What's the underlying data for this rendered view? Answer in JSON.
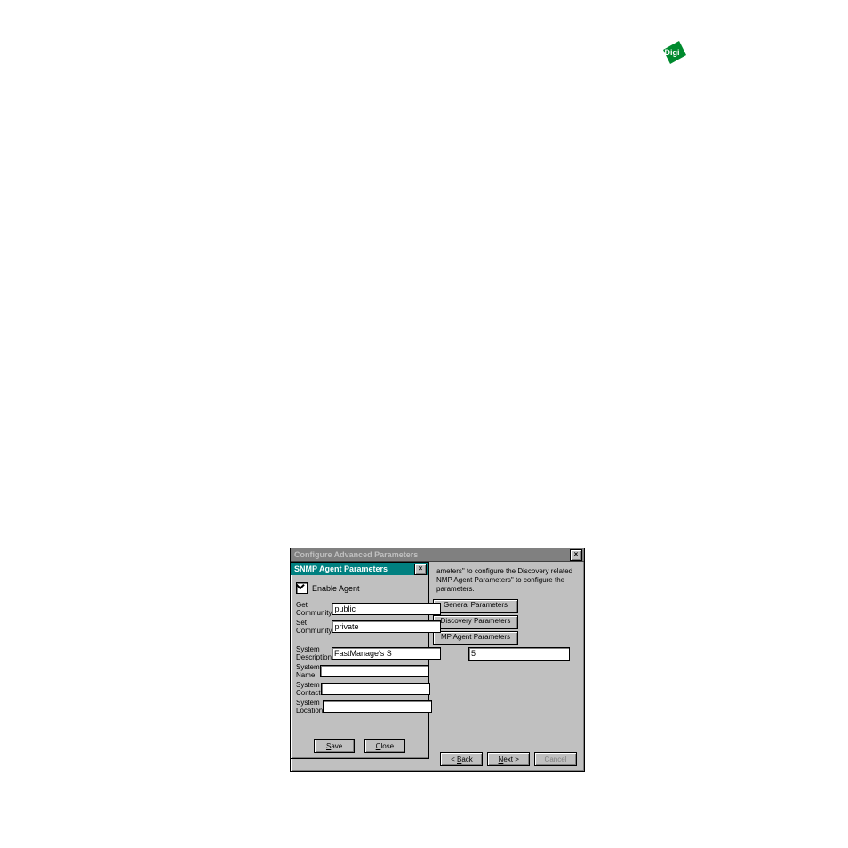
{
  "logo_text": "Digi",
  "outer_dialog": {
    "title": "Configure Advanced Parameters",
    "hint_line1": "ameters\" to configure the Discovery related",
    "hint_line2": "NMP Agent Parameters\" to configure the",
    "hint_line3": "parameters.",
    "buttons": {
      "general": "General Parameters",
      "discovery": "Discovery Parameters",
      "agent": "MP Agent Parameters"
    },
    "num_value": "5",
    "wizard_back": "< Back",
    "wizard_next": "Next >",
    "wizard_cancel": "Cancel"
  },
  "inner_dialog": {
    "title": "SNMP Agent Parameters",
    "enable_label": "Enable Agent",
    "rows": {
      "get_comm_label": "Get Community",
      "get_comm_value": "public",
      "set_comm_label": "Set Community",
      "set_comm_value": "private",
      "sys_desc_label": "System Description",
      "sys_desc_value": "FastManage's S",
      "sys_name_label": "System Name",
      "sys_name_value": "",
      "sys_contact_label": "System Contact",
      "sys_contact_value": "",
      "sys_loc_label": "System Location",
      "sys_loc_value": ""
    },
    "save_label": "Save",
    "close_label": "Close"
  }
}
